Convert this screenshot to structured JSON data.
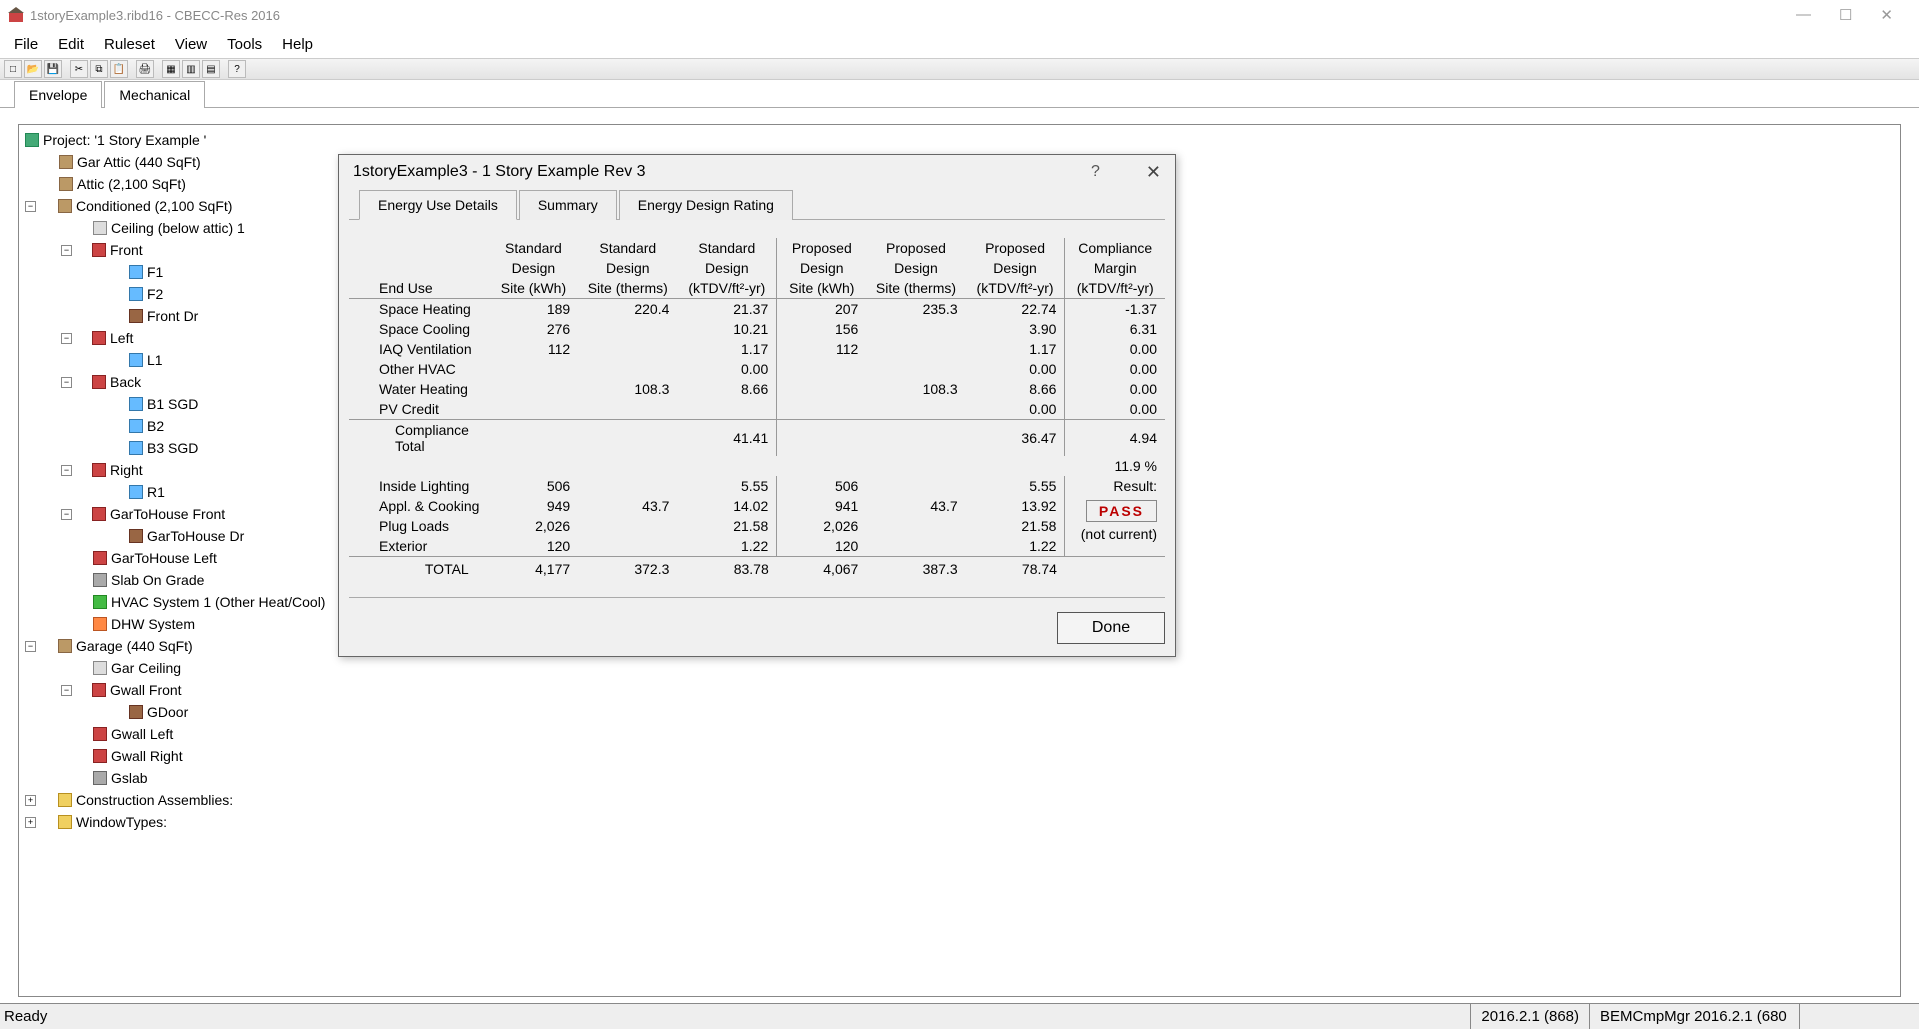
{
  "window": {
    "title": "1storyExample3.ribd16 - CBECC-Res 2016"
  },
  "menu": {
    "file": "File",
    "edit": "Edit",
    "ruleset": "Ruleset",
    "view": "View",
    "tools": "Tools",
    "help": "Help"
  },
  "outer_tabs": {
    "envelope": "Envelope",
    "mechanical": "Mechanical"
  },
  "tree": {
    "project": "Project:   '1 Story Example '",
    "gar_attic": "Gar Attic   (440 SqFt)",
    "attic": "Attic   (2,100 SqFt)",
    "conditioned": "Conditioned  (2,100 SqFt)",
    "ceiling": "Ceiling (below attic) 1",
    "front": "Front",
    "f1": "F1",
    "f2": "F2",
    "front_dr": "Front Dr",
    "left": "Left",
    "l1": "L1",
    "back": "Back",
    "b1": "B1 SGD",
    "b2": "B2",
    "b3": "B3 SGD",
    "right": "Right",
    "r1": "R1",
    "g2h_front": "GarToHouse Front",
    "g2h_dr": "GarToHouse Dr",
    "g2h_left": "GarToHouse Left",
    "slab": "Slab On Grade",
    "hvac": "HVAC System 1  (Other Heat/Cool)",
    "dhw": "DHW System",
    "garage": "Garage  (440 SqFt)",
    "gar_ceiling": "Gar Ceiling",
    "gwall_front": "Gwall Front",
    "gdoor": "GDoor",
    "gwall_left": "Gwall Left",
    "gwall_right": "Gwall Right",
    "gslab": "Gslab",
    "constr": "Construction Assemblies:",
    "wintypes": "WindowTypes:"
  },
  "dialog": {
    "title": "1storyExample3 - 1 Story Example Rev 3",
    "tabs": {
      "details": "Energy Use Details",
      "summary": "Summary",
      "rating": "Energy Design Rating"
    },
    "headers": {
      "enduse": "End Use",
      "std_kwh_1": "Standard",
      "std_kwh_2": "Design",
      "std_kwh_3": "Site (kWh)",
      "std_th_1": "Standard",
      "std_th_2": "Design",
      "std_th_3": "Site (therms)",
      "std_tdv_1": "Standard",
      "std_tdv_2": "Design",
      "std_tdv_3": "(kTDV/ft²-yr)",
      "pro_kwh_1": "Proposed",
      "pro_kwh_2": "Design",
      "pro_kwh_3": "Site (kWh)",
      "pro_th_1": "Proposed",
      "pro_th_2": "Design",
      "pro_th_3": "Site (therms)",
      "pro_tdv_1": "Proposed",
      "pro_tdv_2": "Design",
      "pro_tdv_3": "(kTDV/ft²-yr)",
      "margin_1": "Compliance",
      "margin_2": "Margin",
      "margin_3": "(kTDV/ft²-yr)"
    },
    "rows": {
      "space_heating": {
        "label": "Space Heating",
        "sk": "189",
        "sth": "220.4",
        "stdv": "21.37",
        "pk": "207",
        "pth": "235.3",
        "ptdv": "22.74",
        "m": "-1.37"
      },
      "space_cooling": {
        "label": "Space Cooling",
        "sk": "276",
        "sth": "",
        "stdv": "10.21",
        "pk": "156",
        "pth": "",
        "ptdv": "3.90",
        "m": "6.31"
      },
      "iaq": {
        "label": "IAQ Ventilation",
        "sk": "112",
        "sth": "",
        "stdv": "1.17",
        "pk": "112",
        "pth": "",
        "ptdv": "1.17",
        "m": "0.00"
      },
      "other_hvac": {
        "label": "Other HVAC",
        "sk": "",
        "sth": "",
        "stdv": "0.00",
        "pk": "",
        "pth": "",
        "ptdv": "0.00",
        "m": "0.00"
      },
      "water_heating": {
        "label": "Water Heating",
        "sk": "",
        "sth": "108.3",
        "stdv": "8.66",
        "pk": "",
        "pth": "108.3",
        "ptdv": "8.66",
        "m": "0.00"
      },
      "pv_credit": {
        "label": "PV Credit",
        "sk": "",
        "sth": "",
        "stdv": "",
        "pk": "",
        "pth": "",
        "ptdv": "0.00",
        "m": "0.00"
      },
      "compliance_total": {
        "label": "Compliance Total",
        "sk": "",
        "sth": "",
        "stdv": "41.41",
        "pk": "",
        "pth": "",
        "ptdv": "36.47",
        "m": "4.94"
      },
      "pct": "11.9 %",
      "inside_light": {
        "label": "Inside Lighting",
        "sk": "506",
        "sth": "",
        "stdv": "5.55",
        "pk": "506",
        "pth": "",
        "ptdv": "5.55",
        "m": ""
      },
      "appl": {
        "label": "Appl. & Cooking",
        "sk": "949",
        "sth": "43.7",
        "stdv": "14.02",
        "pk": "941",
        "pth": "43.7",
        "ptdv": "13.92",
        "m": ""
      },
      "plug": {
        "label": "Plug Loads",
        "sk": "2,026",
        "sth": "",
        "stdv": "21.58",
        "pk": "2,026",
        "pth": "",
        "ptdv": "21.58",
        "m": ""
      },
      "exterior": {
        "label": "Exterior",
        "sk": "120",
        "sth": "",
        "stdv": "1.22",
        "pk": "120",
        "pth": "",
        "ptdv": "1.22",
        "m": ""
      },
      "total": {
        "label": "TOTAL",
        "sk": "4,177",
        "sth": "372.3",
        "stdv": "83.78",
        "pk": "4,067",
        "pth": "387.3",
        "ptdv": "78.74",
        "m": ""
      }
    },
    "result_label": "Result:",
    "result_value": "PASS",
    "not_current": "(not current)",
    "done": "Done"
  },
  "status": {
    "ready": "Ready",
    "ver": "2016.2.1 (868)",
    "bem": "BEMCmpMgr 2016.2.1 (680"
  }
}
